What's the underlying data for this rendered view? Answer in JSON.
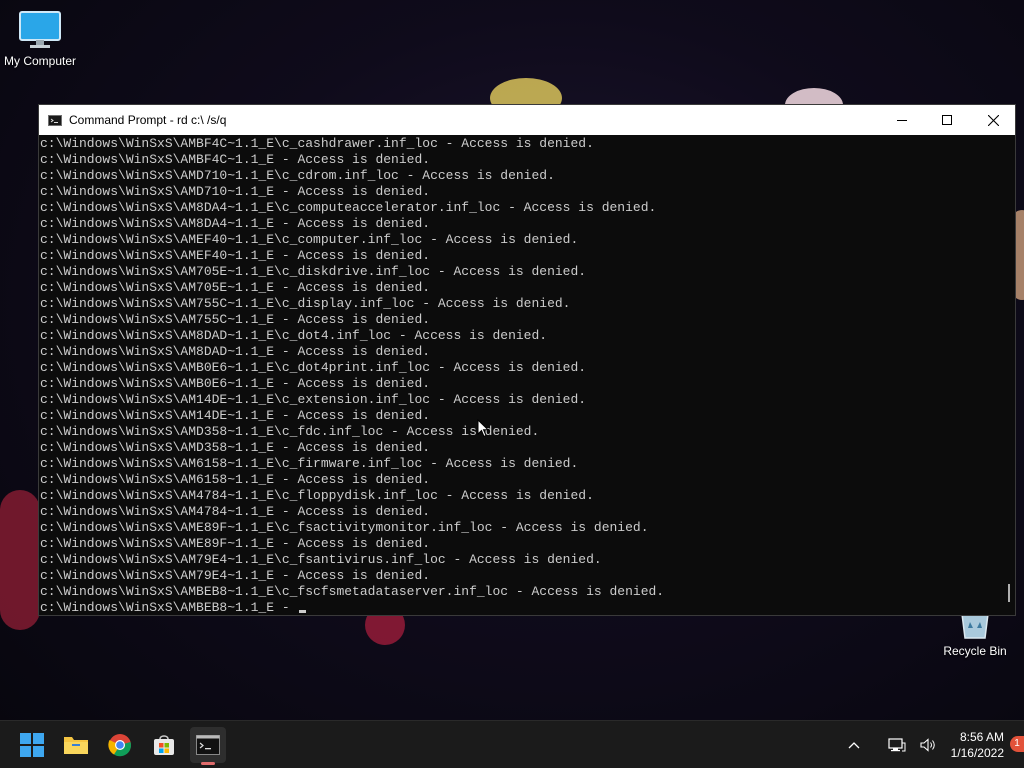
{
  "desktop": {
    "icons": [
      {
        "label": "My Computer",
        "icon": "monitor-icon"
      },
      {
        "label": "Recycle Bin",
        "icon": "recycle-bin-icon"
      }
    ]
  },
  "window": {
    "title": "Command Prompt - rd  c:\\ /s/q",
    "icon": "cmd-icon"
  },
  "console": {
    "lines": [
      "c:\\Windows\\WinSxS\\AMBF4C~1.1_E\\c_cashdrawer.inf_loc - Access is denied.",
      "c:\\Windows\\WinSxS\\AMBF4C~1.1_E - Access is denied.",
      "c:\\Windows\\WinSxS\\AMD710~1.1_E\\c_cdrom.inf_loc - Access is denied.",
      "c:\\Windows\\WinSxS\\AMD710~1.1_E - Access is denied.",
      "c:\\Windows\\WinSxS\\AM8DA4~1.1_E\\c_computeaccelerator.inf_loc - Access is denied.",
      "c:\\Windows\\WinSxS\\AM8DA4~1.1_E - Access is denied.",
      "c:\\Windows\\WinSxS\\AMEF40~1.1_E\\c_computer.inf_loc - Access is denied.",
      "c:\\Windows\\WinSxS\\AMEF40~1.1_E - Access is denied.",
      "c:\\Windows\\WinSxS\\AM705E~1.1_E\\c_diskdrive.inf_loc - Access is denied.",
      "c:\\Windows\\WinSxS\\AM705E~1.1_E - Access is denied.",
      "c:\\Windows\\WinSxS\\AM755C~1.1_E\\c_display.inf_loc - Access is denied.",
      "c:\\Windows\\WinSxS\\AM755C~1.1_E - Access is denied.",
      "c:\\Windows\\WinSxS\\AM8DAD~1.1_E\\c_dot4.inf_loc - Access is denied.",
      "c:\\Windows\\WinSxS\\AM8DAD~1.1_E - Access is denied.",
      "c:\\Windows\\WinSxS\\AMB0E6~1.1_E\\c_dot4print.inf_loc - Access is denied.",
      "c:\\Windows\\WinSxS\\AMB0E6~1.1_E - Access is denied.",
      "c:\\Windows\\WinSxS\\AM14DE~1.1_E\\c_extension.inf_loc - Access is denied.",
      "c:\\Windows\\WinSxS\\AM14DE~1.1_E - Access is denied.",
      "c:\\Windows\\WinSxS\\AMD358~1.1_E\\c_fdc.inf_loc - Access is denied.",
      "c:\\Windows\\WinSxS\\AMD358~1.1_E - Access is denied.",
      "c:\\Windows\\WinSxS\\AM6158~1.1_E\\c_firmware.inf_loc - Access is denied.",
      "c:\\Windows\\WinSxS\\AM6158~1.1_E - Access is denied.",
      "c:\\Windows\\WinSxS\\AM4784~1.1_E\\c_floppydisk.inf_loc - Access is denied.",
      "c:\\Windows\\WinSxS\\AM4784~1.1_E - Access is denied.",
      "c:\\Windows\\WinSxS\\AME89F~1.1_E\\c_fsactivitymonitor.inf_loc - Access is denied.",
      "c:\\Windows\\WinSxS\\AME89F~1.1_E - Access is denied.",
      "c:\\Windows\\WinSxS\\AM79E4~1.1_E\\c_fsantivirus.inf_loc - Access is denied.",
      "c:\\Windows\\WinSxS\\AM79E4~1.1_E - Access is denied.",
      "c:\\Windows\\WinSxS\\AMBEB8~1.1_E\\c_fscfsmetadataserver.inf_loc - Access is denied."
    ],
    "current_line": "c:\\Windows\\WinSxS\\AMBEB8~1.1_E - "
  },
  "taskbar": {
    "apps": [
      {
        "name": "start-button",
        "icon": "windows-logo-icon"
      },
      {
        "name": "file-explorer-button",
        "icon": "folder-icon"
      },
      {
        "name": "chrome-button",
        "icon": "chrome-icon"
      },
      {
        "name": "store-button",
        "icon": "store-icon"
      },
      {
        "name": "terminal-button",
        "icon": "cmd-icon",
        "active": true
      }
    ],
    "clock": {
      "time": "8:56 AM",
      "date": "1/16/2022"
    },
    "notification_count": "1"
  },
  "colors": {
    "console_bg": "#0c0c0c",
    "console_text": "#cccccc",
    "taskbar_bg": "#1b1b1b",
    "accent_active": "#e06c6c"
  }
}
